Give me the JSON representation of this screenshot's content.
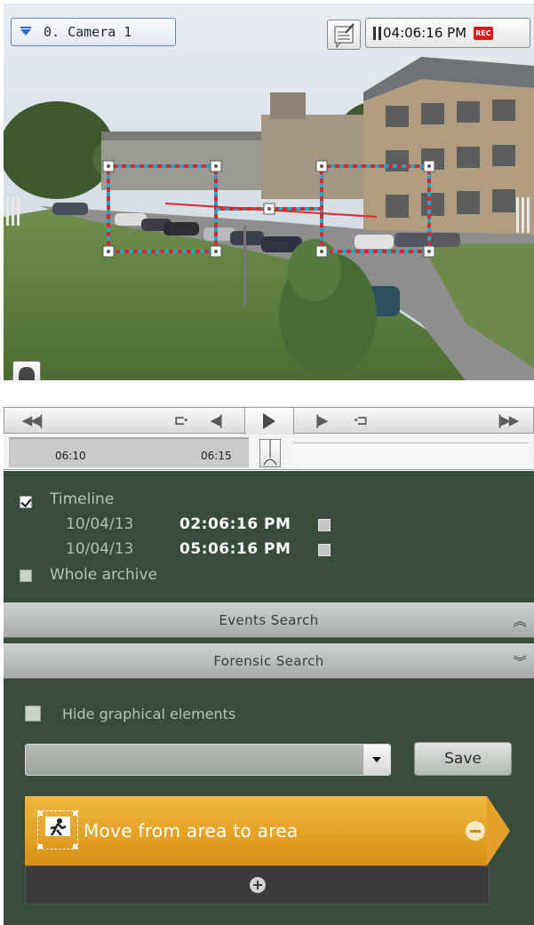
{
  "camera": {
    "name": "0. Camera 1",
    "time": "04:06:16 PM",
    "rec_badge": "REC",
    "icons": {
      "selector": "dropdown-triangle-icon",
      "note": "note-edit-icon",
      "pause": "pause-icon",
      "alarm": "alarm-bell-icon"
    }
  },
  "player": {
    "controls": [
      "skip-to-start-icon",
      "frame-back-end-icon",
      "step-back-icon",
      "play-icon",
      "step-forward-icon",
      "frame-forward-end-icon",
      "skip-to-end-icon"
    ],
    "ticks": [
      "06:10",
      "06:15"
    ]
  },
  "timeline": {
    "label": "Timeline",
    "checked": true,
    "start": {
      "date": "10/04/13",
      "time": "02:06:16 PM"
    },
    "end": {
      "date": "10/04/13",
      "time": "05:06:16 PM"
    }
  },
  "whole_archive": {
    "label": "Whole archive",
    "checked": false
  },
  "events_search": {
    "title": "Events Search",
    "icon": "chevron-double-up-icon"
  },
  "forensic_search": {
    "title": "Forensic Search",
    "icon": "chevron-double-down-icon",
    "hide_graphics": {
      "label": "Hide graphical elements",
      "checked": false
    },
    "preset_value": "",
    "save_label": "Save",
    "rule": {
      "label": "Move from area to area",
      "icon": "walking-person-icon"
    }
  },
  "colors": {
    "panel": "#374d3a",
    "rule": "#e4a02a",
    "zone_line": "#e0262a",
    "zone_dash": "#1aa7c6"
  }
}
